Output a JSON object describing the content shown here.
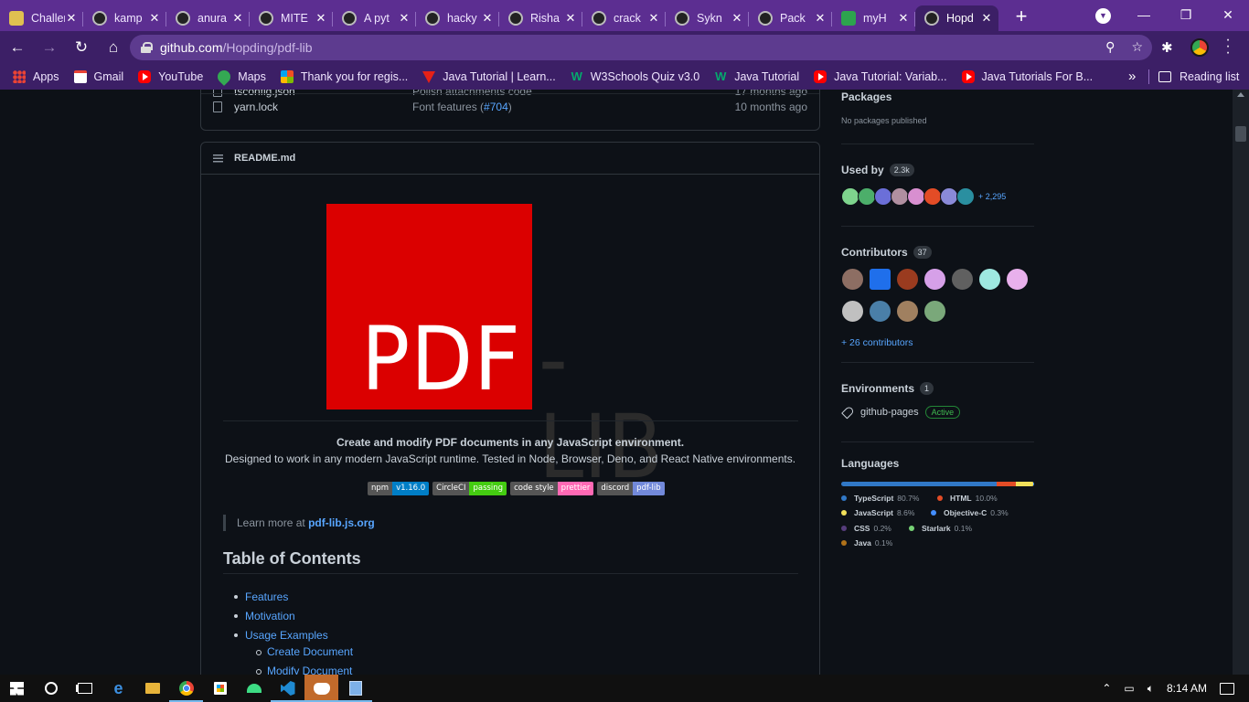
{
  "browser": {
    "tabs": [
      {
        "title": "Challenges",
        "icon": "challenge-icon",
        "active": false
      },
      {
        "title": "kamp",
        "icon": "github-icon",
        "active": false
      },
      {
        "title": "anura",
        "icon": "github-icon",
        "active": false
      },
      {
        "title": "MITE",
        "icon": "github-icon",
        "active": false
      },
      {
        "title": "A pyt",
        "icon": "github-icon",
        "active": false
      },
      {
        "title": "hacky",
        "icon": "github-icon",
        "active": false
      },
      {
        "title": "Risha",
        "icon": "github-icon",
        "active": false
      },
      {
        "title": "crack",
        "icon": "github-icon",
        "active": false
      },
      {
        "title": "Sykn",
        "icon": "github-icon",
        "active": false
      },
      {
        "title": "Pack",
        "icon": "github-icon",
        "active": false
      },
      {
        "title": "myH",
        "icon": "download-icon",
        "active": false
      },
      {
        "title": "Hopd",
        "icon": "github-icon",
        "active": true
      }
    ],
    "new_tab_label": "+",
    "window": {
      "minimize": "—",
      "maximize": "❐",
      "close": "✕"
    },
    "address": {
      "domain": "github.com",
      "path": "/Hopding/pdf-lib"
    },
    "bookmarks": [
      {
        "label": "Apps",
        "icon": "apps-icon"
      },
      {
        "label": "Gmail",
        "icon": "gmail-icon"
      },
      {
        "label": "YouTube",
        "icon": "youtube-icon"
      },
      {
        "label": "Maps",
        "icon": "maps-icon"
      },
      {
        "label": "Thank you for regis...",
        "icon": "microsoft-icon"
      },
      {
        "label": "Java Tutorial | Learn...",
        "icon": "vtutor-icon"
      },
      {
        "label": "W3Schools Quiz v3.0",
        "icon": "w3schools-icon"
      },
      {
        "label": "Java Tutorial",
        "icon": "w3schools-icon"
      },
      {
        "label": "Java Tutorial: Variab...",
        "icon": "youtube-icon"
      },
      {
        "label": "Java Tutorials For B...",
        "icon": "youtube-icon"
      }
    ],
    "bookmarks_more": "»",
    "reading_list": "Reading list"
  },
  "repo": {
    "files": [
      {
        "name": "tsconfig.json",
        "message": "Polish attachments code",
        "link": "",
        "age": "17 months ago"
      },
      {
        "name": "yarn.lock",
        "message": "Font features (",
        "link": "#704",
        "message_end": ")",
        "age": "10 months ago"
      }
    ],
    "readme": {
      "filename": "README.md",
      "logo_left": "PDF",
      "logo_right": "-LIB",
      "tagline": "Create and modify PDF documents in any JavaScript environment.",
      "tagline2": "Designed to work in any modern JavaScript runtime. Tested in Node, Browser, Deno, and React Native environments.",
      "badges": [
        {
          "label": "npm",
          "value": "v1.16.0",
          "color": "#007ec6"
        },
        {
          "label": "CircleCI",
          "value": "passing",
          "color": "#4c1"
        },
        {
          "label": "code style",
          "value": "prettier",
          "color": "#ff69b4"
        },
        {
          "label": "discord",
          "value": "pdf-lib",
          "color": "#7289da"
        }
      ],
      "learn_more_prefix": "Learn more at",
      "learn_more_link": "pdf-lib.js.org",
      "toc_heading": "Table of Contents",
      "toc": [
        "Features",
        "Motivation",
        "Usage Examples"
      ],
      "toc_sub": [
        "Create Document",
        "Modify Document"
      ]
    },
    "sidebar": {
      "packages_heading": "Packages",
      "packages_note": "No packages published",
      "used_by_heading": "Used by",
      "used_by_count": "2.3k",
      "used_by_more": "+ 2,295",
      "contributors_heading": "Contributors",
      "contributors_count": "37",
      "contributors_more": "+ 26 contributors",
      "environments_heading": "Environments",
      "environments_count": "1",
      "environment_name": "github-pages",
      "environment_status": "Active",
      "languages_heading": "Languages",
      "languages": [
        {
          "name": "TypeScript",
          "percent": "80.7%",
          "value": 80.7,
          "color": "#3178c6"
        },
        {
          "name": "HTML",
          "percent": "10.0%",
          "value": 10.0,
          "color": "#e34c26"
        },
        {
          "name": "JavaScript",
          "percent": "8.6%",
          "value": 8.6,
          "color": "#f1e05a"
        },
        {
          "name": "Objective-C",
          "percent": "0.3%",
          "value": 0.3,
          "color": "#438eff"
        },
        {
          "name": "CSS",
          "percent": "0.2%",
          "value": 0.2,
          "color": "#563d7c"
        },
        {
          "name": "Starlark",
          "percent": "0.1%",
          "value": 0.1,
          "color": "#76d275"
        },
        {
          "name": "Java",
          "percent": "0.1%",
          "value": 0.1,
          "color": "#b07219"
        }
      ]
    }
  },
  "taskbar": {
    "time": "8:14 AM"
  }
}
